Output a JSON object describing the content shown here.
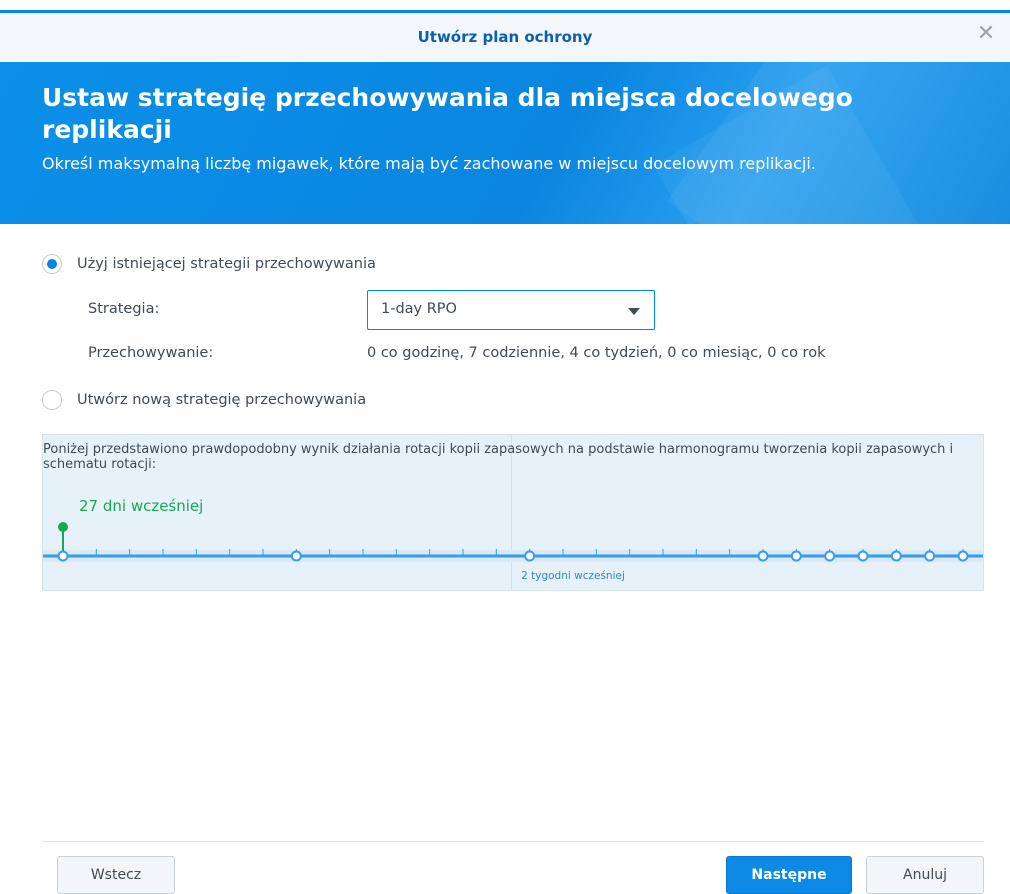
{
  "dialog": {
    "title": "Utwórz plan ochrony",
    "close_glyph": "✕"
  },
  "banner": {
    "heading": "Ustaw strategię przechowywania dla miejsca docelowego replikacji",
    "description": "Określ maksymalną liczbę migawek, które mają być zachowane w miejscu docelowym replikacji."
  },
  "options": {
    "use_existing": {
      "label": "Użyj istniejącej strategii przechowywania",
      "selected": true
    },
    "create_new": {
      "label": "Utwórz nową strategię przechowywania",
      "selected": false
    }
  },
  "fields": {
    "strategy_label": "Strategia:",
    "strategy_value": "1-day RPO",
    "retention_label": "Przechowywanie:",
    "retention_value": "0 co godzinę, 7 codziennie, 4 co tydzień, 0 co miesiąc, 0 co rok"
  },
  "preview": {
    "description": "Poniżej przedstawiono prawdopodobny wynik działania rotacji kopii zapasowych na podstawie harmonogramu tworzenia kopii zapasowych i schematu rotacji:",
    "oldest_label": "27 dni wcześniej",
    "midpoint_label": "2 tygodni wcześniej",
    "accent_color": "#18a94f",
    "line_color": "#3a9be8",
    "snapshot_days_ago": [
      27,
      20,
      13,
      6,
      5,
      4,
      3,
      2,
      1,
      0
    ]
  },
  "buttons": {
    "back": "Wstecz",
    "next": "Następne",
    "cancel": "Anuluj"
  },
  "icons": {
    "close": "close-icon",
    "dropdown": "chevron-down-icon"
  }
}
